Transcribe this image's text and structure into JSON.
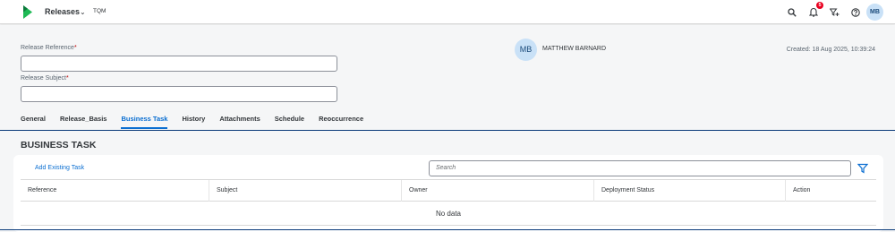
{
  "shell": {
    "app_title": "Releases",
    "app_subtitle": "TQM",
    "notification_count": "5",
    "user_initials": "MB",
    "icons": [
      "search-icon",
      "bell-icon",
      "filter-add-icon",
      "help-icon"
    ]
  },
  "header": {
    "release_reference_label": "Release Reference",
    "release_reference_value": "",
    "release_subject_label": "Release Subject",
    "release_subject_value": "",
    "required_mark": "*",
    "user_initials": "MB",
    "user_name": "MATTHEW BARNARD",
    "created": "Created: 18 Aug 2025, 10:39:24"
  },
  "tabs": [
    {
      "label": "General",
      "active": false
    },
    {
      "label": "Release_Basis",
      "active": false
    },
    {
      "label": "Business Task",
      "active": true
    },
    {
      "label": "History",
      "active": false
    },
    {
      "label": "Attachments",
      "active": false
    },
    {
      "label": "Schedule",
      "active": false
    },
    {
      "label": "Reoccurrence",
      "active": false
    }
  ],
  "section": {
    "title": "BUSINESS TASK",
    "add_existing": "Add Existing Task",
    "search_placeholder": "Search",
    "columns": [
      "Reference",
      "Subject",
      "Owner",
      "Deployment Status",
      "Action"
    ],
    "empty_text": "No data"
  },
  "colors": {
    "accent": "#0a6ed1",
    "brand_green": "#1db954",
    "badge": "#e9001f"
  }
}
